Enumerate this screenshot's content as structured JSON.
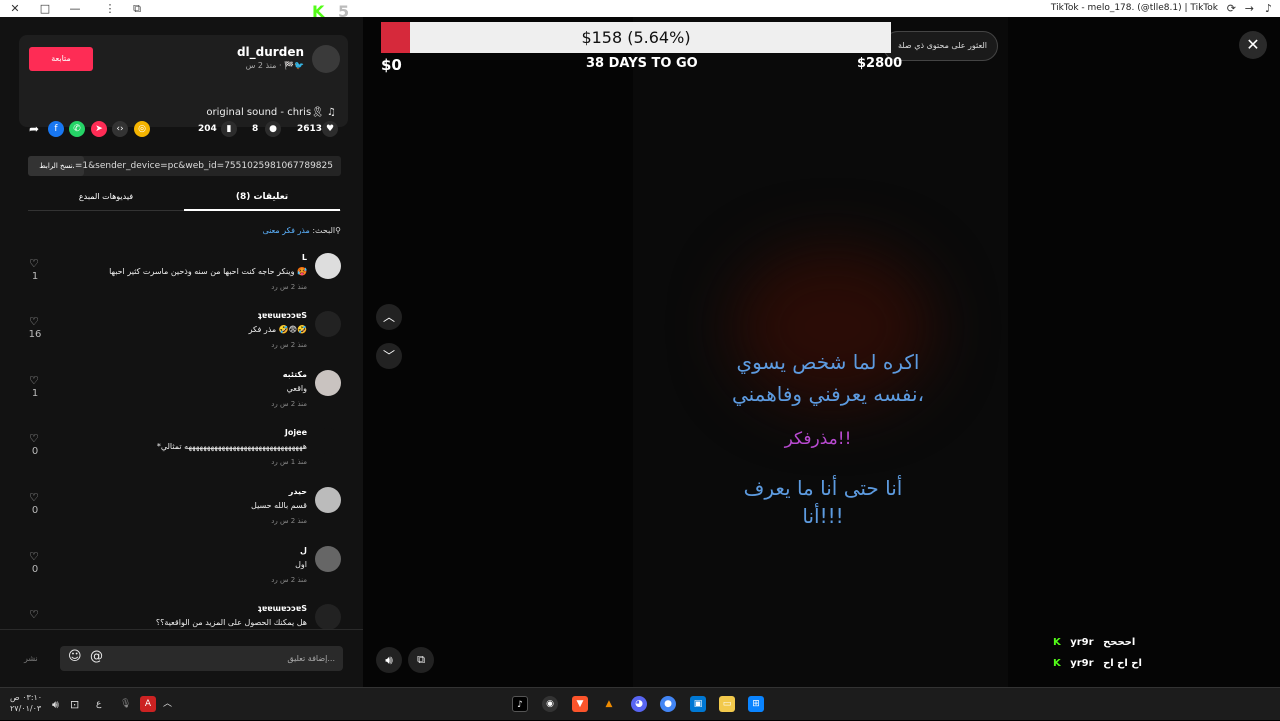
{
  "window": {
    "title": "TikTok - melo_178. (@tlle8.1) | TikTok",
    "min_label": "—",
    "max_label": "□",
    "close_label": "✕",
    "menu_label": "⋮"
  },
  "donation": {
    "amount_text": "$158 (5.64%)",
    "progress_fraction": 0.0564,
    "min_label": "$0",
    "max_label": "$2800",
    "days_label": "38 DAYS TO GO",
    "kick_number": "5"
  },
  "video_header": {
    "related_label": "العثور على محتوى ذي صلة",
    "close_icon": "✕"
  },
  "author": {
    "follow_label": "متابعة",
    "username": "dl_durden",
    "meta": "منذ 2 س · 🏁🐦",
    "sound": "original sound - chris🎗 ♫"
  },
  "actions": {
    "likes": "2613",
    "comments": "8",
    "saves": "204"
  },
  "share_link": {
    "copy_label": "نسخ الرابط",
    "url": "...=1&sender_device=pc&web_id=7551025981067789825"
  },
  "tabs": {
    "comments": "(8) تعليقات",
    "creator_videos": "فيديوهات المبدع"
  },
  "search": {
    "prefix": "البحث:",
    "query": "مذر فكر معنى"
  },
  "comments": [
    {
      "user": "L",
      "text": "وينكر حاجه كنت احبها من سنه وذحين ماسرت كثير احبها 🥵",
      "meta": "منذ 2 س   رد",
      "likes": "1"
    },
    {
      "user": "ʇɐɐɯɐɔɔɐS",
      "text": "مذر فكر 🤣😨🤣",
      "meta": "منذ 2 س   رد",
      "likes": "16"
    },
    {
      "user": "مكتئبه",
      "text": "واقعي",
      "meta": "منذ 2 س   رد",
      "likes": "1"
    },
    {
      "user": "Jojee",
      "text": "*ههههههههههههههههههههههههههههههههه تمثالي",
      "meta": "منذ 1 س   رد",
      "likes": "0"
    },
    {
      "user": "حيدر",
      "text": "قسم بالله حسيل",
      "meta": "منذ 2 س   رد",
      "likes": "0"
    },
    {
      "user": "ل",
      "text": "اول",
      "meta": "منذ 2 س   رد",
      "likes": "0"
    },
    {
      "user": "ʇɐɐɯɐɔɔɐS",
      "text": "هل يمكنك الحصول على المزيد من الواقعية؟؟",
      "meta": "",
      "likes": ""
    }
  ],
  "comment_box": {
    "placeholder": "إضافة تعليق...",
    "post_label": "نشر",
    "mention_icon": "@",
    "emoji_icon": "☺"
  },
  "subtitles": {
    "line1": "اكره لما شخص يسوي",
    "line2": "نفسه يعرفني وفاهمني،",
    "line3": "مذرفكر!!",
    "line4": "أنا حتى أنا ما يعرف",
    "line5": "أنا!!!"
  },
  "chat": [
    {
      "user": "yr9r",
      "message": "احححح"
    },
    {
      "user": "yr9r",
      "message": "اح اح اح"
    }
  ],
  "taskbar": {
    "time": "٠٣:١٠ ص",
    "date": "٢٧/٠١/٠٣",
    "lang": "ع"
  },
  "colors": {
    "accent": "#fe2c55",
    "progress_red": "#d6293b",
    "kick_green": "#53fc18",
    "subtitle_blue": "#5d9be0",
    "subtitle_purple": "#b84ad0"
  }
}
